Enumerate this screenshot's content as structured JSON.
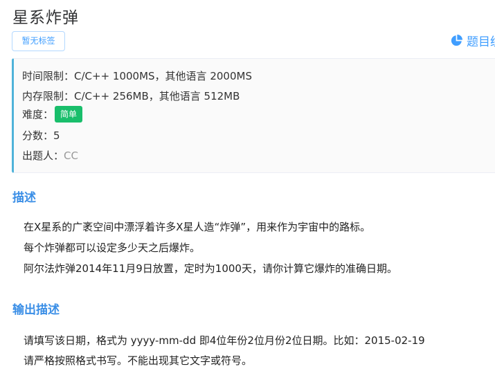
{
  "problem": {
    "title": "星系炸弹",
    "tag_button_label": "暂无标签",
    "stats_link_label": "题目统计"
  },
  "info": {
    "time_limit_label": "时间限制：",
    "time_limit_value": "C/C++ 1000MS，其他语言 2000MS",
    "memory_limit_label": "内存限制：",
    "memory_limit_value": "C/C++ 256MB，其他语言 512MB",
    "difficulty_label": "难度：",
    "difficulty_value": "简单",
    "score_label": "分数：",
    "score_value": "5",
    "author_label": "出题人：",
    "author_value": "CC"
  },
  "description": {
    "heading": "描述",
    "lines": [
      "在X星系的广袤空间中漂浮着许多X星人造“炸弹”，用来作为宇宙中的路标。",
      "每个炸弹都可以设定多少天之后爆炸。",
      "阿尔法炸弹2014年11月9日放置，定时为1000天，请你计算它爆炸的准确日期。"
    ]
  },
  "output": {
    "heading": "输出描述",
    "lines": [
      "请填写该日期，格式为 yyyy-mm-dd 即4位年份2位月份2位日期。比如：2015-02-19",
      "请严格按照格式书写。不能出现其它文字或符号。"
    ]
  },
  "colors": {
    "accent": "#409eff",
    "heading": "#3a8ee6",
    "info_border": "#4eb2d9",
    "difficulty_badge": "#19be6b"
  },
  "icons": {
    "stats": "pie-chart-icon"
  }
}
